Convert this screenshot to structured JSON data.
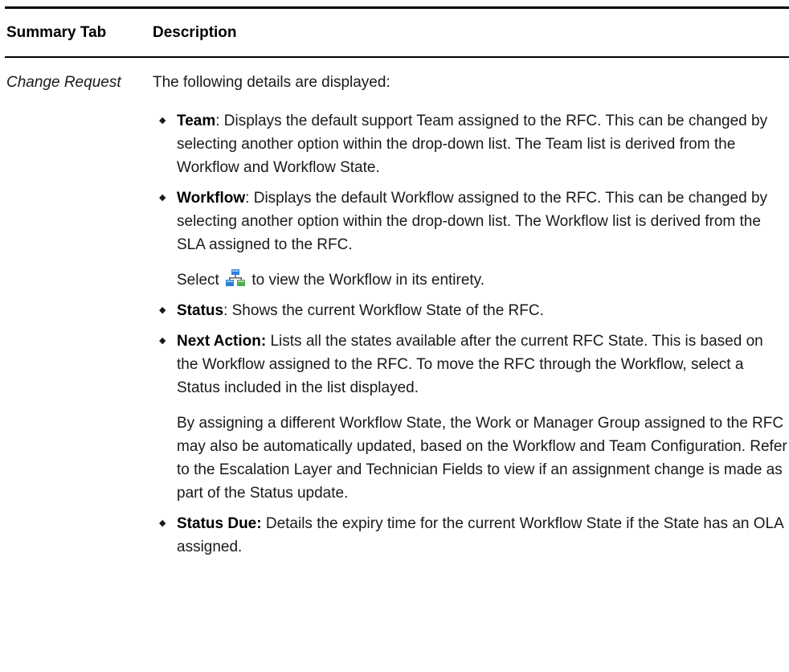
{
  "table": {
    "header_col1": "Summary Tab",
    "header_col2": "Description"
  },
  "row": {
    "label": "Change Request",
    "intro": "The following details are displayed:",
    "items": [
      {
        "term": "Team",
        "sep": ":",
        "text": " Displays the default support Team assigned to the RFC. This can be changed by selecting another option within the drop-down list. The Team list is derived from the Workflow and Workflow State."
      },
      {
        "term": "Workflow",
        "sep": ":",
        "text": " Displays the default Workflow assigned to the RFC. This can be changed by selecting another option within the drop-down list. The Workflow list is derived from the SLA assigned to the RFC.",
        "sub_before": "Select ",
        "sub_icon": "workflow-diagram-icon",
        "sub_after": " to view the Workflow in its entirety."
      },
      {
        "term": "Status",
        "sep": ":",
        "text": " Shows the current Workflow State of the RFC."
      },
      {
        "term": "Next Action:",
        "sep": "",
        "text": " Lists all the states available after the current RFC State. This is based on the Workflow assigned to the RFC. To move the RFC through the Workflow, select a Status included in the list displayed.",
        "sub_para": "By assigning a different Workflow State, the Work or Manager Group assigned to the RFC may also be automatically updated, based on the Workflow and Team Configuration. Refer to the Escalation Layer and Technician Fields to view if an assignment change is made as part of the Status update."
      },
      {
        "term": "Status Due:",
        "sep": "",
        "text": " Details the expiry time for the current Workflow State if the State has an OLA assigned."
      }
    ]
  },
  "colors": {
    "rule": "#000000",
    "text": "#1a1a1a",
    "icon_blue": "#2f7ed8",
    "icon_green": "#4caf50"
  }
}
